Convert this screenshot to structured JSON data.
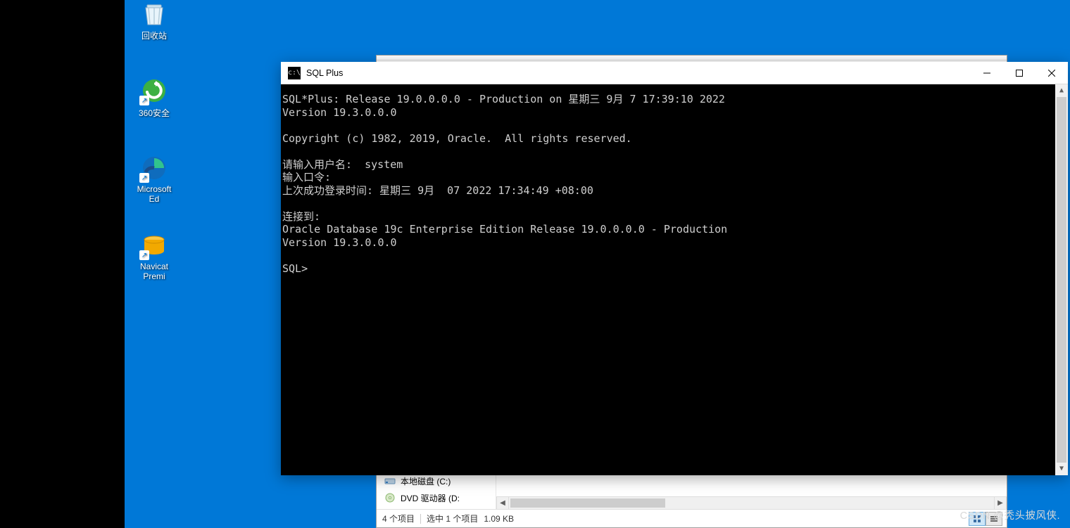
{
  "desktop": {
    "icons": {
      "recycle_bin": "回收站",
      "security360": "360安全",
      "edge": "Microsoft Ed",
      "navicat": "Navicat Premi"
    }
  },
  "explorer": {
    "sidebar": {
      "local_disk": "本地磁盘 (C:)",
      "dvd_drive": "DVD 驱动器 (D:"
    },
    "status": {
      "item_count": "4 个项目",
      "selected": "选中 1 个项目",
      "size": "1.09 KB"
    }
  },
  "terminal_window": {
    "title": "SQL Plus",
    "lines": [
      "SQL*Plus: Release 19.0.0.0.0 - Production on 星期三 9月 7 17:39:10 2022",
      "Version 19.3.0.0.0",
      "",
      "Copyright (c) 1982, 2019, Oracle.  All rights reserved.",
      "",
      "请输入用户名:  system",
      "输入口令:",
      "上次成功登录时间: 星期三 9月  07 2022 17:34:49 +08:00",
      "",
      "连接到:",
      "Oracle Database 19c Enterprise Edition Release 19.0.0.0.0 - Production",
      "Version 19.3.0.0.0",
      "",
      "SQL>"
    ]
  },
  "watermark": "CSDN @秃头披风侠."
}
